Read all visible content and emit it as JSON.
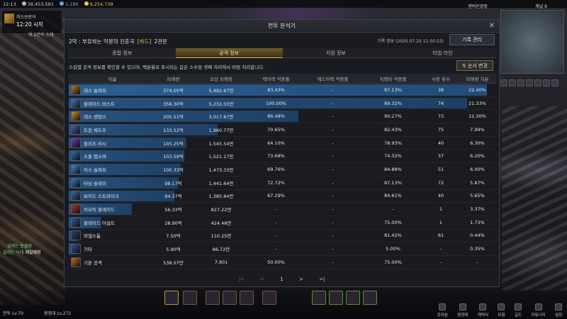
{
  "topbar": {
    "time": "12:13",
    "silver": "38,453,581",
    "crystal": "1,190",
    "gold": "9,254,739"
  },
  "quest": {
    "name": "지스브로어",
    "time": "12:20 시작",
    "sub": "외 1건의 스케"
  },
  "header_right": {
    "guild": "엔버린광장",
    "channel": "채널 9"
  },
  "window": {
    "title": "전투 분석기",
    "raid": "2막 : 부유하는 악몽의 진혼곡",
    "difficulty": "[하드]",
    "gate": "2관문",
    "record_info": "기록 정보 (2025.07.25 11:50:23)",
    "record_button": "기록 관리",
    "close": "✕"
  },
  "tabs": [
    {
      "label": "종합 정보",
      "active": false
    },
    {
      "label": "공격 정보",
      "active": true
    },
    {
      "label": "지원 정보",
      "active": false
    },
    {
      "label": "타임 라인",
      "active": false
    }
  ],
  "hint": "스킬별 공격 정보를 확인할 수 있으며, 백분율로 표시되는 값은 소수점 셋째 자리에서 버림 처리합니다.",
  "sort_button": "순서 변경",
  "columns": [
    "이름",
    "피해량",
    "초당 피해량",
    "백어택 적중률",
    "헤드어택 적중률",
    "치명타 적중률",
    "사용 횟수",
    "피해량 지분"
  ],
  "rows": [
    {
      "name": "데스 슬래쉬",
      "dmg": "374.05억",
      "dps": "5,492.67만",
      "back": "83.43%",
      "head": "-",
      "crit": "87.13%",
      "casts": "38",
      "share": "22.40%",
      "share_v": 22.4,
      "icon_color": "#b07a2a"
    },
    {
      "name": "블레이드 버스트",
      "dmg": "356.30억",
      "dps": "5,232.03만",
      "back": "100.00%",
      "head": "-",
      "crit": "89.32%",
      "casts": "74",
      "share": "21.33%",
      "share_v": 21.33,
      "icon_color": "#3a7cc4"
    },
    {
      "name": "데스 센텐스",
      "dmg": "205.51억",
      "dps": "3,017.87만",
      "back": "86.48%",
      "head": "-",
      "crit": "90.27%",
      "casts": "73",
      "share": "12.30%",
      "share_v": 12.3,
      "icon_color": "#c89030"
    },
    {
      "name": "트윈 쉐도우",
      "dmg": "133.52억",
      "dps": "1,960.77만",
      "back": "70.65%",
      "head": "-",
      "crit": "82.43%",
      "casts": "75",
      "share": "7.99%",
      "share_v": 7.99,
      "icon_color": "#4a5aa8"
    },
    {
      "name": "블리츠 러시",
      "dmg": "105.25억",
      "dps": "1,545.54만",
      "back": "64.10%",
      "head": "-",
      "crit": "78.93%",
      "casts": "40",
      "share": "6.30%",
      "share_v": 6.3,
      "icon_color": "#6a3ab0"
    },
    {
      "name": "소울 앱소버",
      "dmg": "103.59억",
      "dps": "1,521.17만",
      "back": "73.68%",
      "head": "-",
      "crit": "74.32%",
      "casts": "37",
      "share": "6.20%",
      "share_v": 6.2,
      "icon_color": "#2a6ab8"
    },
    {
      "name": "어스 슬래쉬",
      "dmg": "100.33억",
      "dps": "1,473.33만",
      "back": "69.76%",
      "head": "-",
      "crit": "84.88%",
      "casts": "51",
      "share": "6.00%",
      "share_v": 6.0,
      "icon_color": "#3a8ad0"
    },
    {
      "name": "터닝 슬래쉬",
      "dmg": "98.17억",
      "dps": "1,441.64만",
      "back": "72.72%",
      "head": "-",
      "crit": "87.13%",
      "casts": "72",
      "share": "5.87%",
      "share_v": 5.87,
      "icon_color": "#2a7ac8"
    },
    {
      "name": "보이드 스트라이크",
      "dmg": "94.37억",
      "dps": "1,385.84만",
      "back": "67.29%",
      "head": "-",
      "crit": "84.61%",
      "casts": "40",
      "share": "5.65%",
      "share_v": 5.65,
      "icon_color": "#3a6ab0"
    },
    {
      "name": "카오틱 블레이드",
      "dmg": "56.33억",
      "dps": "827.22만",
      "back": "-",
      "head": "-",
      "crit": "-",
      "casts": "1",
      "share": "3.37%",
      "share_v": 3.37,
      "icon_color": "#b03030"
    },
    {
      "name": "블레이드 어설트",
      "dmg": "28.90억",
      "dps": "424.48만",
      "back": "-",
      "head": "-",
      "crit": "75.00%",
      "casts": "1",
      "share": "1.73%",
      "share_v": 1.73,
      "icon_color": "#2a5aa0"
    },
    {
      "name": "마엘스톰",
      "dmg": "7.50억",
      "dps": "110.25만",
      "back": "-",
      "head": "-",
      "crit": "81.42%",
      "casts": "61",
      "share": "0.44%",
      "share_v": 0.44,
      "icon_color": "#304070"
    },
    {
      "name": "기타",
      "dmg": "5.90억",
      "dps": "86.72만",
      "back": "-",
      "head": "-",
      "crit": "5.00%",
      "casts": "-",
      "share": "0.35%",
      "share_v": 0.35,
      "icon_color": "#3a4a8a"
    },
    {
      "name": "기본 공격",
      "dmg": "538.07만",
      "dps": "7,901",
      "back": "50.00%",
      "head": "-",
      "crit": "75.00%",
      "casts": "-",
      "share": "-",
      "share_v": 0,
      "icon_color": "#c06a20"
    }
  ],
  "pager": {
    "first": "|<",
    "prev": "<",
    "page": "1",
    "next": ">",
    "last": ">|"
  },
  "chat": {
    "line1": "설레는 동물원",
    "line2_prefix": "설레는 늑대",
    "line2_name": "제갈혜청"
  },
  "bottom": {
    "level": "전투 Lv.70",
    "guild_level": "원정대 Lv.272"
  },
  "menu": [
    {
      "label": "로아샵"
    },
    {
      "label": "원정대"
    },
    {
      "label": "캐릭터"
    },
    {
      "label": "모험"
    },
    {
      "label": "길드"
    },
    {
      "label": "커뮤니티"
    },
    {
      "label": "설정"
    }
  ]
}
